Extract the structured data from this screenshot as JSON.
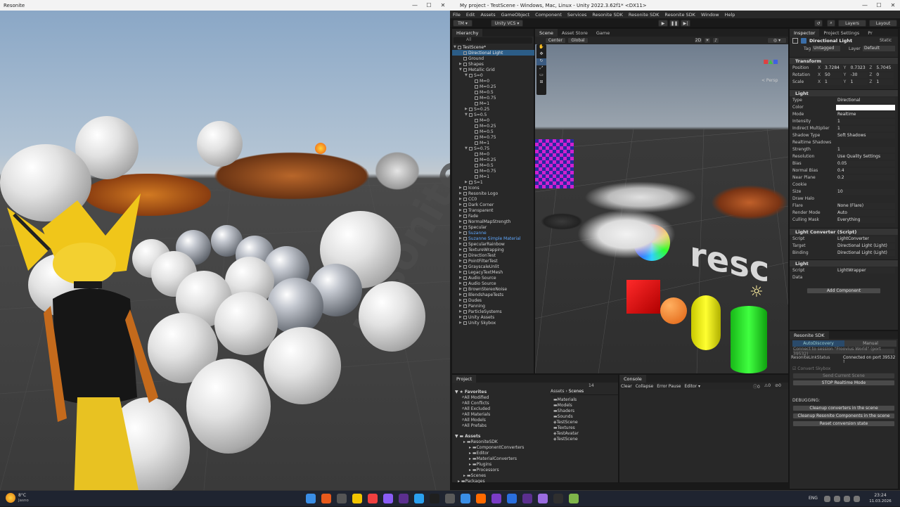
{
  "resonite": {
    "title": "Resonite",
    "world_text": "resonite"
  },
  "unity": {
    "title": "My project - TestScene - Windows, Mac, Linux - Unity 2022.3.62f1* <DX11>",
    "menu": [
      "File",
      "Edit",
      "Assets",
      "GameObject",
      "Component",
      "Services",
      "Resonite SDK",
      "Resonite SDK",
      "Resonite SDK",
      "Window",
      "Help"
    ],
    "toolbar": {
      "account": "TM ▾",
      "vcs": "Unity VCS ▾",
      "layers": "Layers",
      "layout": "Layout"
    },
    "hierarchy": {
      "tab": "Hierarchy",
      "search": "All",
      "items": [
        {
          "t": "TestScene*",
          "d": 0,
          "a": "▼",
          "c": "#e6e6e6"
        },
        {
          "t": "Directional Light",
          "d": 1,
          "a": "",
          "c": "#e6e6e6",
          "sel": true
        },
        {
          "t": "Ground",
          "d": 1,
          "a": "",
          "c": "#cfcfcf"
        },
        {
          "t": "Shapes",
          "d": 1,
          "a": "▶",
          "c": "#cfcfcf"
        },
        {
          "t": "Metallic Grid",
          "d": 1,
          "a": "▼",
          "c": "#cfcfcf"
        },
        {
          "t": "S=0",
          "d": 2,
          "a": "▼",
          "c": "#cfcfcf"
        },
        {
          "t": "M=0",
          "d": 3,
          "a": "",
          "c": "#cfcfcf"
        },
        {
          "t": "M=0.25",
          "d": 3,
          "a": "",
          "c": "#cfcfcf"
        },
        {
          "t": "M=0.5",
          "d": 3,
          "a": "",
          "c": "#cfcfcf"
        },
        {
          "t": "M=0.75",
          "d": 3,
          "a": "",
          "c": "#cfcfcf"
        },
        {
          "t": "M=1",
          "d": 3,
          "a": "",
          "c": "#cfcfcf"
        },
        {
          "t": "S=0.25",
          "d": 2,
          "a": "▶",
          "c": "#cfcfcf"
        },
        {
          "t": "S=0.5",
          "d": 2,
          "a": "▼",
          "c": "#cfcfcf"
        },
        {
          "t": "M=0",
          "d": 3,
          "a": "",
          "c": "#cfcfcf"
        },
        {
          "t": "M=0.25",
          "d": 3,
          "a": "",
          "c": "#cfcfcf"
        },
        {
          "t": "M=0.5",
          "d": 3,
          "a": "",
          "c": "#cfcfcf"
        },
        {
          "t": "M=0.75",
          "d": 3,
          "a": "",
          "c": "#cfcfcf"
        },
        {
          "t": "M=1",
          "d": 3,
          "a": "",
          "c": "#cfcfcf"
        },
        {
          "t": "S=0.75",
          "d": 2,
          "a": "▼",
          "c": "#cfcfcf"
        },
        {
          "t": "M=0",
          "d": 3,
          "a": "",
          "c": "#cfcfcf"
        },
        {
          "t": "M=0.25",
          "d": 3,
          "a": "",
          "c": "#cfcfcf"
        },
        {
          "t": "M=0.5",
          "d": 3,
          "a": "",
          "c": "#cfcfcf"
        },
        {
          "t": "M=0.75",
          "d": 3,
          "a": "",
          "c": "#cfcfcf"
        },
        {
          "t": "M=1",
          "d": 3,
          "a": "",
          "c": "#cfcfcf"
        },
        {
          "t": "S=1",
          "d": 2,
          "a": "▶",
          "c": "#cfcfcf"
        },
        {
          "t": "Icons",
          "d": 1,
          "a": "▶",
          "c": "#cfcfcf"
        },
        {
          "t": "Resonite Logo",
          "d": 1,
          "a": "▶",
          "c": "#cfcfcf"
        },
        {
          "t": "CC0",
          "d": 1,
          "a": "▶",
          "c": "#cfcfcf"
        },
        {
          "t": "Dark Corner",
          "d": 1,
          "a": "▶",
          "c": "#cfcfcf"
        },
        {
          "t": "Transparent",
          "d": 1,
          "a": "▶",
          "c": "#cfcfcf"
        },
        {
          "t": "Fade",
          "d": 1,
          "a": "▶",
          "c": "#cfcfcf"
        },
        {
          "t": "NormalMapStrength",
          "d": 1,
          "a": "▶",
          "c": "#cfcfcf"
        },
        {
          "t": "Specular",
          "d": 1,
          "a": "▶",
          "c": "#cfcfcf"
        },
        {
          "t": "Suzanne",
          "d": 1,
          "a": "▶",
          "c": "#5fa8ff"
        },
        {
          "t": "Suzanne Simple Material",
          "d": 1,
          "a": "▶",
          "c": "#5fa8ff"
        },
        {
          "t": "SpecularRainbow",
          "d": 1,
          "a": "▶",
          "c": "#cfcfcf"
        },
        {
          "t": "TextureWrapping",
          "d": 1,
          "a": "▶",
          "c": "#cfcfcf"
        },
        {
          "t": "DirectionTest",
          "d": 1,
          "a": "▶",
          "c": "#cfcfcf"
        },
        {
          "t": "PointFilterTest",
          "d": 1,
          "a": "▶",
          "c": "#cfcfcf"
        },
        {
          "t": "GrayscaleUnlit",
          "d": 1,
          "a": "▶",
          "c": "#cfcfcf"
        },
        {
          "t": "LegacyTextMesh",
          "d": 1,
          "a": "▶",
          "c": "#cfcfcf"
        },
        {
          "t": "Audio Source",
          "d": 1,
          "a": "▶",
          "c": "#cfcfcf"
        },
        {
          "t": "Audio Source",
          "d": 1,
          "a": "▶",
          "c": "#cfcfcf"
        },
        {
          "t": "BrownStereoNoise",
          "d": 1,
          "a": "▶",
          "c": "#cfcfcf"
        },
        {
          "t": "BlendshapeTests",
          "d": 1,
          "a": "▶",
          "c": "#cfcfcf"
        },
        {
          "t": "Dudes",
          "d": 1,
          "a": "▶",
          "c": "#cfcfcf"
        },
        {
          "t": "Panning",
          "d": 1,
          "a": "▶",
          "c": "#cfcfcf"
        },
        {
          "t": "ParticleSystems",
          "d": 1,
          "a": "▶",
          "c": "#cfcfcf"
        },
        {
          "t": "Unity Assets",
          "d": 1,
          "a": "▶",
          "c": "#cfcfcf"
        },
        {
          "t": "Unity Skybox",
          "d": 1,
          "a": "▶",
          "c": "#cfcfcf"
        }
      ]
    },
    "scene": {
      "tabs": [
        "Scene",
        "Asset Store",
        "Game"
      ],
      "pivot": "Center",
      "space": "Global",
      "mode": "2D",
      "persp": "< Persp",
      "world_text": "resc"
    },
    "inspector": {
      "tabs": [
        "Inspector",
        "Project Settings",
        "Pr"
      ],
      "object_name": "Directional Light",
      "static": "Static",
      "tag_label": "Tag",
      "tag": "Untagged",
      "layer_label": "Layer",
      "layer": "Default",
      "transform": {
        "title": "Transform",
        "rows": [
          {
            "l": "Position",
            "x": "3.7284",
            "y": "0.7323",
            "z": "5.7045"
          },
          {
            "l": "Rotation",
            "x": "50",
            "y": "-30",
            "z": "0"
          },
          {
            "l": "Scale",
            "x": "1",
            "y": "1",
            "z": "1"
          }
        ]
      },
      "light": {
        "title": "Light",
        "props": [
          {
            "l": "Type",
            "v": "Directional"
          },
          {
            "l": "Color",
            "v": ""
          },
          {
            "l": "Mode",
            "v": "Realtime"
          },
          {
            "l": "Intensity",
            "v": "1"
          },
          {
            "l": "Indirect Multiplier",
            "v": "1"
          },
          {
            "l": "Shadow Type",
            "v": "Soft Shadows"
          },
          {
            "l": "Realtime Shadows",
            "v": ""
          },
          {
            "l": "Strength",
            "v": "1"
          },
          {
            "l": "Resolution",
            "v": "Use Quality Settings"
          },
          {
            "l": "Bias",
            "v": "0.05"
          },
          {
            "l": "Normal Bias",
            "v": "0.4"
          },
          {
            "l": "Near Plane",
            "v": "0.2"
          },
          {
            "l": "Cookie",
            "v": ""
          },
          {
            "l": "Size",
            "v": "10"
          },
          {
            "l": "Draw Halo",
            "v": ""
          },
          {
            "l": "Flare",
            "v": "None (Flare)"
          },
          {
            "l": "Render Mode",
            "v": "Auto"
          },
          {
            "l": "Culling Mask",
            "v": "Everything"
          }
        ]
      },
      "converter": {
        "title": "Light Converter (Script)",
        "props": [
          {
            "l": "Script",
            "v": "LightConverter"
          },
          {
            "l": "Target",
            "v": "Directional Light (Light)"
          },
          {
            "l": "Binding",
            "v": "Directional Light (Light)"
          }
        ]
      },
      "light2": {
        "title": "Light",
        "props": [
          {
            "l": "Script",
            "v": "LightWrapper"
          },
          {
            "l": "Data",
            "v": ""
          }
        ]
      },
      "add_component": "Add Component"
    },
    "sdk": {
      "title": "Resonite SDK",
      "tabs": [
        "AutoDiscovery",
        "Manual"
      ],
      "connect": "Connect to session \"Froovius World\" (port 39532)",
      "status_label": "ResoniteLinkStatus",
      "status": "Connected on port 39532 !",
      "convert_skybox": "Convert Skybox",
      "send_scene": "Send Current Scene",
      "stop_mode": "STOP Realtime Mode",
      "debugging": "DEBUGGING:",
      "dbg_buttons": [
        "Cleanup converters in the scene",
        "Cleanup Resonite Components in the scene",
        "Reset conversion state"
      ]
    },
    "project": {
      "tab": "Project",
      "count": "14",
      "favorites": {
        "title": "Favorites",
        "items": [
          "All Modified",
          "All Conflicts",
          "All Excluded",
          "All Materials",
          "All Models",
          "All Prefabs"
        ]
      },
      "assets": {
        "title": "Assets",
        "items": [
          "ResoniteSDK",
          "ComponentConverters",
          "Editor",
          "MaterialConverters",
          "Plugins",
          "Processors",
          "Scenes",
          "Packages"
        ]
      },
      "breadcrumb": [
        "Assets",
        "Scenes"
      ],
      "files": [
        "Materials",
        "Models",
        "Shaders",
        "Sounds",
        "TestScene",
        "Textures",
        "TestAvatar",
        "TestScene"
      ]
    },
    "console": {
      "tab": "Console",
      "buttons": [
        "Clear",
        "Collapse",
        "Error Pause",
        "Editor ▾"
      ],
      "counts": [
        "0",
        "0",
        "0"
      ]
    }
  },
  "taskbar": {
    "weather": "8°C",
    "weather_sub": "Jasno",
    "lang": "ENG",
    "time": "23:24",
    "date": "11.03.2026"
  }
}
